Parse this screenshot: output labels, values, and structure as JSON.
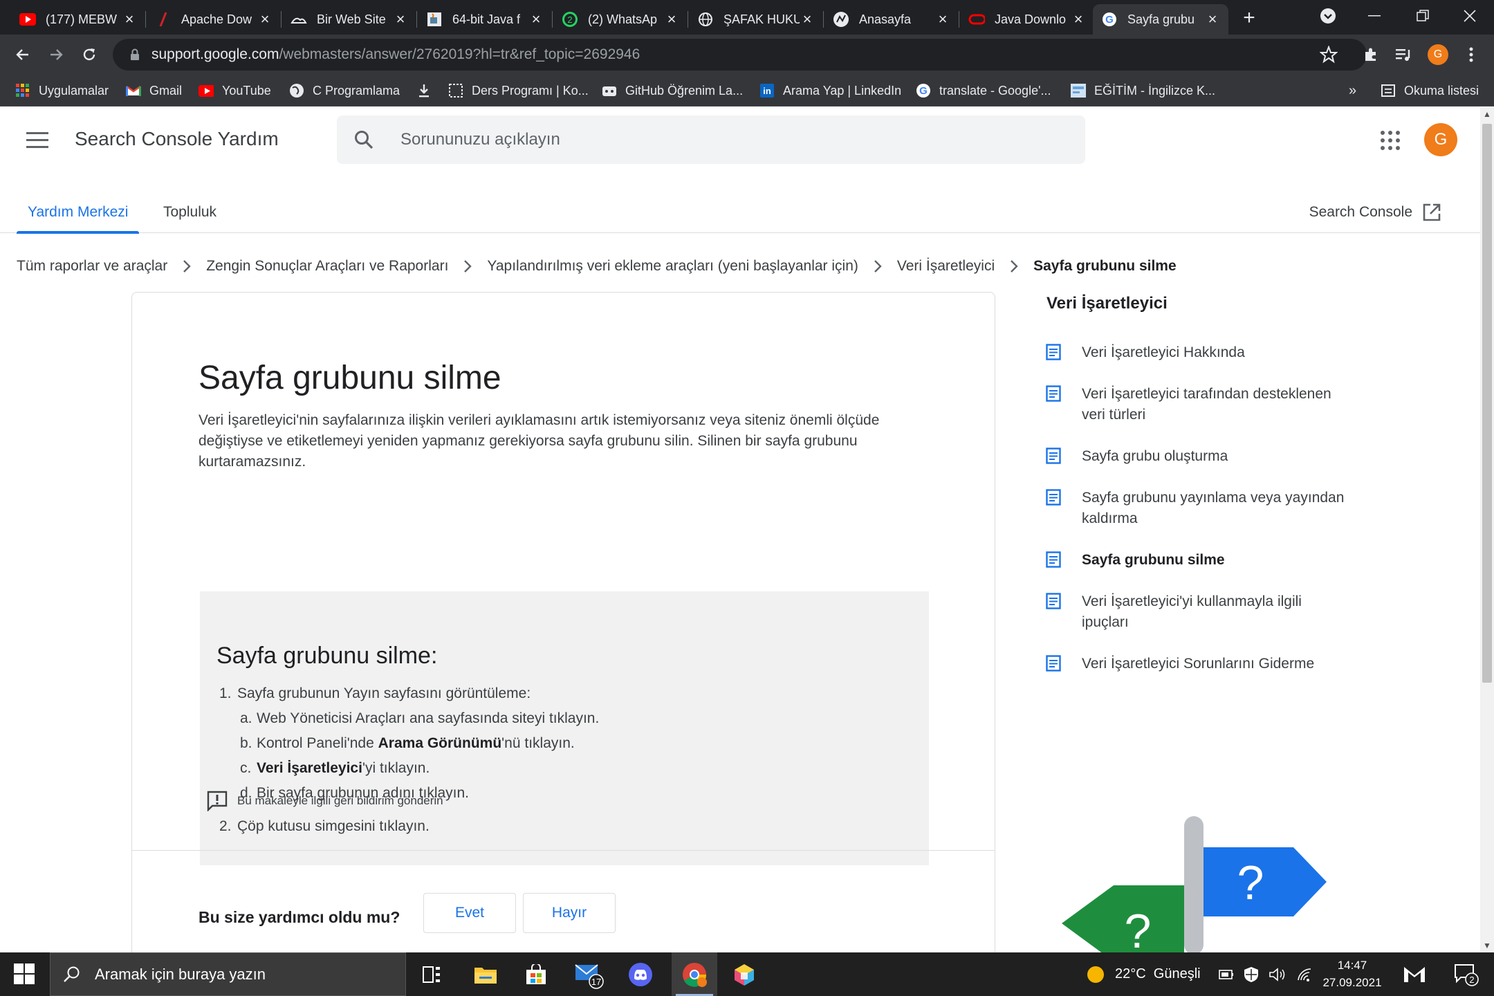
{
  "browser": {
    "tabs": [
      {
        "title": "(177) MEBW",
        "icon": "youtube-icon"
      },
      {
        "title": "Apache Dow",
        "icon": "apache-icon"
      },
      {
        "title": "Bir Web Site",
        "icon": "web-icon"
      },
      {
        "title": "64-bit Java f",
        "icon": "java-icon"
      },
      {
        "title": "(2) WhatsAp",
        "icon": "whatsapp-icon",
        "badge": "2"
      },
      {
        "title": "ŞAFAK HUKU",
        "icon": "globe-icon"
      },
      {
        "title": "Anasayfa",
        "icon": "site-icon"
      },
      {
        "title": "Java Downlo",
        "icon": "oracle-icon"
      },
      {
        "title": "Sayfa grubu",
        "icon": "google-icon",
        "active": true
      }
    ],
    "url_host": "support.google.com",
    "url_path": "/webmasters/answer/2762019?hl=tr&ref_topic=2692946",
    "profile_initial": "G",
    "bookmarks": [
      {
        "label": "Uygulamalar",
        "icon": "apps-grid-icon"
      },
      {
        "label": "Gmail",
        "icon": "gmail-icon"
      },
      {
        "label": "YouTube",
        "icon": "youtube-icon"
      },
      {
        "label": "C Programlama",
        "icon": "globe-icon"
      },
      {
        "label": "",
        "icon": "download-icon"
      },
      {
        "label": "Ders Programı | Ko...",
        "icon": "calendar-icon"
      },
      {
        "label": "GitHub Öğrenim La...",
        "icon": "github-icon"
      },
      {
        "label": "Arama Yap | LinkedIn",
        "icon": "linkedin-icon"
      },
      {
        "label": "translate - Google'...",
        "icon": "google-icon"
      },
      {
        "label": "EĞİTİM - İngilizce K...",
        "icon": "bookmark-site-icon"
      }
    ],
    "bookmarks_overflow": "»",
    "reading_list": "Okuma listesi"
  },
  "header": {
    "product": "Search Console Yardım",
    "search_placeholder": "Sorununuzu açıklayın",
    "avatar_initial": "G"
  },
  "subnav": {
    "tabs": [
      {
        "label": "Yardım Merkezi",
        "active": true
      },
      {
        "label": "Topluluk"
      }
    ],
    "external_link": "Search Console"
  },
  "breadcrumb": [
    "Tüm raporlar ve araçlar",
    "Zengin Sonuçlar Araçları ve Raporları",
    "Yapılandırılmış veri ekleme araçları (yeni başlayanlar için)",
    "Veri İşaretleyici",
    "Sayfa grubunu silme"
  ],
  "article": {
    "title": "Sayfa grubunu silme",
    "intro": "Veri İşaretleyici'nin sayfalarınıza ilişkin verileri ayıklamasını artık istemiyorsanız veya siteniz önemli ölçüde değiştiyse ve etiketlemeyi yeniden yapmanız gerekiyorsa sayfa grubunu silin. Silinen bir sayfa grubunu kurtaramazsınız.",
    "steps_title": "Sayfa grubunu silme:",
    "step1_num": "1.",
    "step1": "Sayfa grubunun Yayın sayfasını görüntüleme:",
    "sub_a_num": "a.",
    "sub_a": "Web Yöneticisi Araçları ana sayfasında siteyi tıklayın.",
    "sub_b_num": "b.",
    "sub_b_pre": "Kontrol Paneli'nde ",
    "sub_b_bold": "Arama Görünümü",
    "sub_b_post": "'nü tıklayın.",
    "sub_c_num": "c.",
    "sub_c_bold": "Veri İşaretleyici",
    "sub_c_post": "'yi tıklayın.",
    "sub_d_num": "d.",
    "sub_d": "Bir sayfa grubunun adını tıklayın.",
    "step2_num": "2.",
    "step2": "Çöp kutusu simgesini tıklayın.",
    "feedback": "Bu makaleyle ilgili geri bildirim gönderin",
    "helpful_q": "Bu size yardımcı oldu mu?",
    "yes": "Evet",
    "no": "Hayır"
  },
  "sidenav": {
    "title": "Veri İşaretleyici",
    "items": [
      {
        "line1": "Veri İşaretleyici Hakkında",
        "line2": ""
      },
      {
        "line1": "Veri İşaretleyici tarafından desteklenen",
        "line2": "veri türleri"
      },
      {
        "line1": "Sayfa grubu oluşturma",
        "line2": ""
      },
      {
        "line1": "Sayfa grubunu yayınlama veya yayından",
        "line2": "kaldırma"
      },
      {
        "line1": "Sayfa grubunu silme",
        "line2": "",
        "current": true
      },
      {
        "line1": "Veri İşaretleyici'yi kullanmayla ilgili",
        "line2": "ipuçları"
      },
      {
        "line1": "Veri İşaretleyici Sorunlarını Giderme",
        "line2": ""
      }
    ]
  },
  "signpost": {
    "mark": "?"
  },
  "taskbar": {
    "search_placeholder": "Aramak için buraya yazın",
    "mail_badge": "17",
    "weather": "22°C  Güneşli",
    "time": "14:47",
    "date": "27.09.2021",
    "notifications": "2"
  },
  "colors": {
    "accent": "#1a73e8",
    "avatar": "#f07c1a",
    "steps_bg": "#f1f1f1",
    "chrome_dark": "#202124",
    "chrome_toolbar": "#35363a"
  }
}
